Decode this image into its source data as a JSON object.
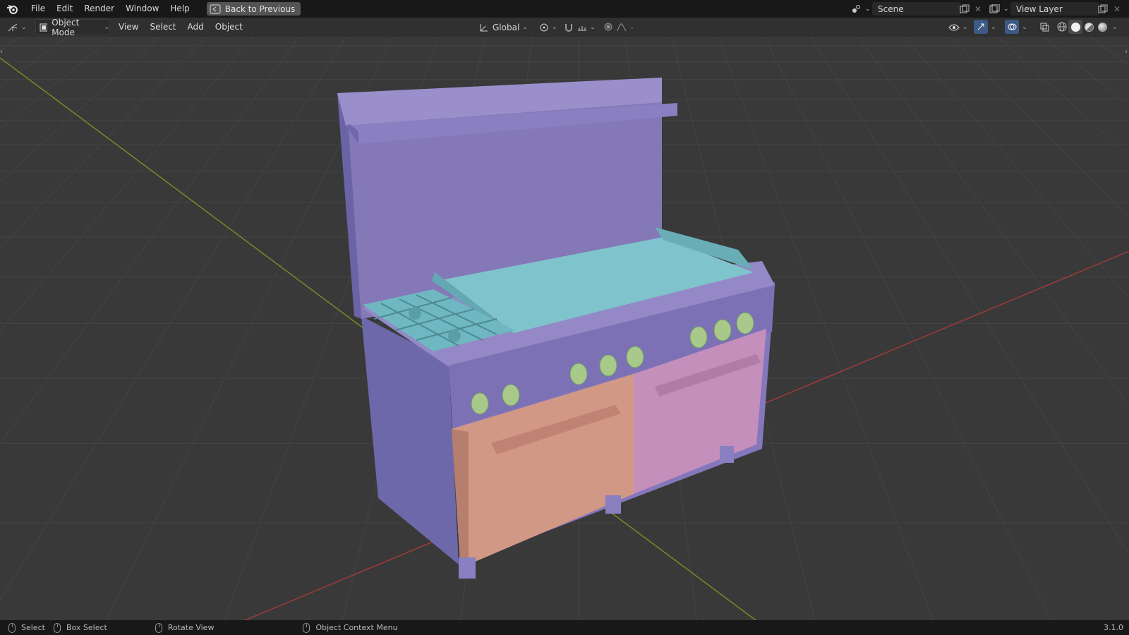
{
  "menu": {
    "items": [
      "File",
      "Edit",
      "Render",
      "Window",
      "Help"
    ],
    "back_label": "Back to Previous"
  },
  "scene": {
    "name": "Scene"
  },
  "view_layer": {
    "name": "View Layer"
  },
  "header": {
    "mode_label": "Object Mode",
    "menus": [
      "View",
      "Select",
      "Add",
      "Object"
    ],
    "transform_orientation": "Global"
  },
  "status": {
    "select": "Select",
    "box_select": "Box Select",
    "rotate_view": "Rotate View",
    "context_menu": "Object Context Menu",
    "version": "3.1.0"
  },
  "colors": {
    "axis_x": "#a33b3b",
    "axis_y": "#7a8f2a",
    "body": "#8a7fc0",
    "griddle": "#7fc4cc",
    "left_door": "#d29886",
    "right_door": "#c58fbc",
    "knob": "#a9c98a"
  }
}
